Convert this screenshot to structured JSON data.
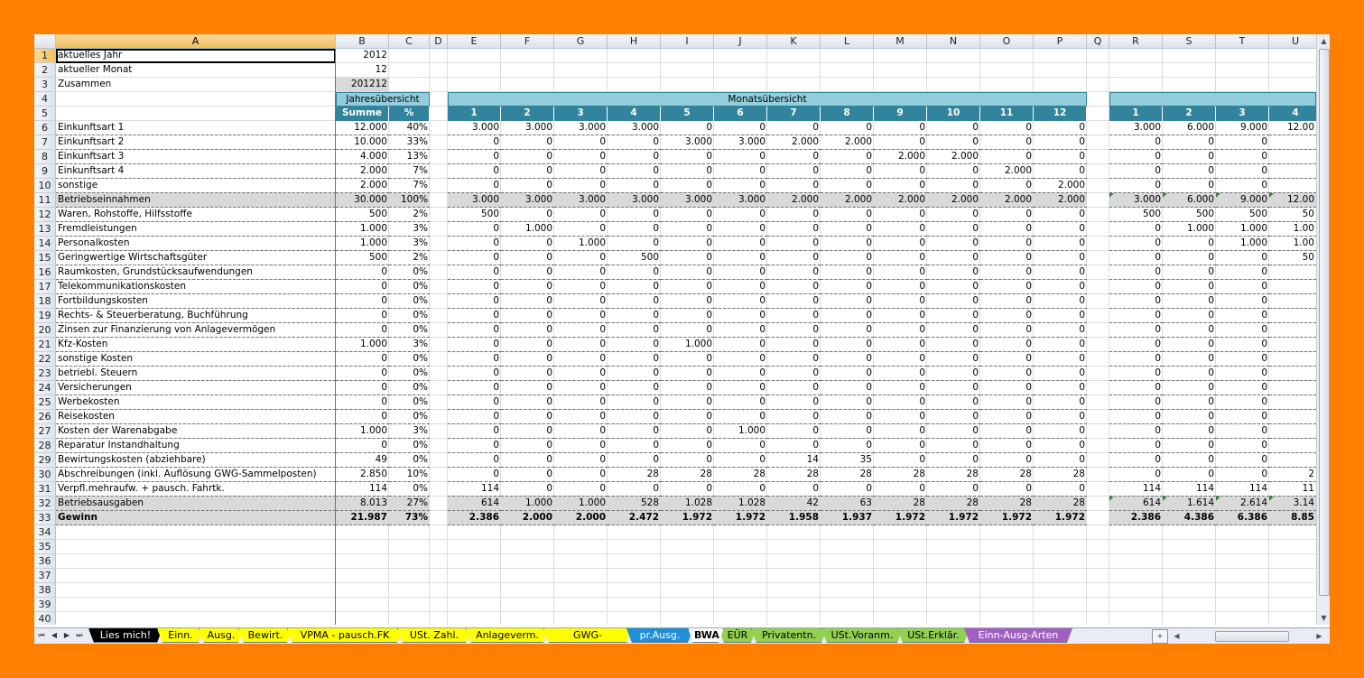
{
  "columns": [
    "A",
    "B",
    "C",
    "D",
    "E",
    "F",
    "G",
    "H",
    "I",
    "J",
    "K",
    "L",
    "M",
    "N",
    "O",
    "P",
    "Q",
    "R",
    "S",
    "T",
    "U"
  ],
  "selected_column": "A",
  "selected_row": 1,
  "header_block": {
    "jahres": "Jahresübersicht",
    "monats": "Monatsübersicht",
    "summe": "Summe",
    "percent": "%",
    "months": [
      "1",
      "2",
      "3",
      "4",
      "5",
      "6",
      "7",
      "8",
      "9",
      "10",
      "11",
      "12"
    ],
    "cum_months": [
      "1",
      "2",
      "3",
      "4"
    ]
  },
  "rows": [
    {
      "n": "1",
      "label": "aktuelles Jahr",
      "b": "2012"
    },
    {
      "n": "2",
      "label": "aktueller Monat",
      "b": "12"
    },
    {
      "n": "3",
      "label": "Zusammen",
      "b": "201212"
    },
    {
      "n": "4"
    },
    {
      "n": "5"
    },
    {
      "n": "6",
      "label": "Einkunftsart 1",
      "b": "12.000",
      "c": "40%",
      "m": [
        "3.000",
        "3.000",
        "3.000",
        "3.000",
        "0",
        "0",
        "0",
        "0",
        "0",
        "0",
        "0",
        "0"
      ],
      "r": [
        "3.000",
        "6.000",
        "9.000",
        "12.00"
      ]
    },
    {
      "n": "7",
      "label": "Einkunftsart 2",
      "b": "10.000",
      "c": "33%",
      "m": [
        "0",
        "0",
        "0",
        "0",
        "3.000",
        "3.000",
        "2.000",
        "2.000",
        "0",
        "0",
        "0",
        "0"
      ],
      "r": [
        "0",
        "0",
        "0",
        ""
      ]
    },
    {
      "n": "8",
      "label": "Einkunftsart 3",
      "b": "4.000",
      "c": "13%",
      "m": [
        "0",
        "0",
        "0",
        "0",
        "0",
        "0",
        "0",
        "0",
        "2.000",
        "2.000",
        "0",
        "0"
      ],
      "r": [
        "0",
        "0",
        "0",
        ""
      ]
    },
    {
      "n": "9",
      "label": "Einkunftsart 4",
      "b": "2.000",
      "c": "7%",
      "m": [
        "0",
        "0",
        "0",
        "0",
        "0",
        "0",
        "0",
        "0",
        "0",
        "0",
        "2.000",
        "0"
      ],
      "r": [
        "0",
        "0",
        "0",
        ""
      ]
    },
    {
      "n": "10",
      "label": "sonstige",
      "b": "2.000",
      "c": "7%",
      "m": [
        "0",
        "0",
        "0",
        "0",
        "0",
        "0",
        "0",
        "0",
        "0",
        "0",
        "0",
        "2.000"
      ],
      "r": [
        "0",
        "0",
        "0",
        ""
      ]
    },
    {
      "n": "11",
      "label": "Betriebseinnahmen",
      "b": "30.000",
      "c": "100%",
      "m": [
        "3.000",
        "3.000",
        "3.000",
        "3.000",
        "3.000",
        "3.000",
        "2.000",
        "2.000",
        "2.000",
        "2.000",
        "2.000",
        "2.000"
      ],
      "r": [
        "3.000",
        "6.000",
        "9.000",
        "12.00"
      ],
      "style": "grey"
    },
    {
      "n": "12",
      "label": "Waren, Rohstoffe, Hilfsstoffe",
      "b": "500",
      "c": "2%",
      "m": [
        "500",
        "0",
        "0",
        "0",
        "0",
        "0",
        "0",
        "0",
        "0",
        "0",
        "0",
        "0"
      ],
      "r": [
        "500",
        "500",
        "500",
        "50"
      ]
    },
    {
      "n": "13",
      "label": "Fremdleistungen",
      "b": "1.000",
      "c": "3%",
      "m": [
        "0",
        "1.000",
        "0",
        "0",
        "0",
        "0",
        "0",
        "0",
        "0",
        "0",
        "0",
        "0"
      ],
      "r": [
        "0",
        "1.000",
        "1.000",
        "1.00"
      ]
    },
    {
      "n": "14",
      "label": "Personalkosten",
      "b": "1.000",
      "c": "3%",
      "m": [
        "0",
        "0",
        "1.000",
        "0",
        "0",
        "0",
        "0",
        "0",
        "0",
        "0",
        "0",
        "0"
      ],
      "r": [
        "0",
        "0",
        "1.000",
        "1.00"
      ]
    },
    {
      "n": "15",
      "label": "Geringwertige Wirtschaftsgüter",
      "b": "500",
      "c": "2%",
      "m": [
        "0",
        "0",
        "0",
        "500",
        "0",
        "0",
        "0",
        "0",
        "0",
        "0",
        "0",
        "0"
      ],
      "r": [
        "0",
        "0",
        "0",
        "50"
      ]
    },
    {
      "n": "16",
      "label": "Raumkosten, Grundstücksaufwendungen",
      "b": "0",
      "c": "0%",
      "m": [
        "0",
        "0",
        "0",
        "0",
        "0",
        "0",
        "0",
        "0",
        "0",
        "0",
        "0",
        "0"
      ],
      "r": [
        "0",
        "0",
        "0",
        ""
      ]
    },
    {
      "n": "17",
      "label": "Telekommunikationskosten",
      "b": "0",
      "c": "0%",
      "m": [
        "0",
        "0",
        "0",
        "0",
        "0",
        "0",
        "0",
        "0",
        "0",
        "0",
        "0",
        "0"
      ],
      "r": [
        "0",
        "0",
        "0",
        ""
      ]
    },
    {
      "n": "18",
      "label": "Fortbildungskosten",
      "b": "0",
      "c": "0%",
      "m": [
        "0",
        "0",
        "0",
        "0",
        "0",
        "0",
        "0",
        "0",
        "0",
        "0",
        "0",
        "0"
      ],
      "r": [
        "0",
        "0",
        "0",
        ""
      ]
    },
    {
      "n": "19",
      "label": "Rechts- & Steuerberatung, Buchführung",
      "b": "0",
      "c": "0%",
      "m": [
        "0",
        "0",
        "0",
        "0",
        "0",
        "0",
        "0",
        "0",
        "0",
        "0",
        "0",
        "0"
      ],
      "r": [
        "0",
        "0",
        "0",
        ""
      ]
    },
    {
      "n": "20",
      "label": "Zinsen zur Finanzierung von Anlagevermögen",
      "b": "0",
      "c": "0%",
      "m": [
        "0",
        "0",
        "0",
        "0",
        "0",
        "0",
        "0",
        "0",
        "0",
        "0",
        "0",
        "0"
      ],
      "r": [
        "0",
        "0",
        "0",
        ""
      ]
    },
    {
      "n": "21",
      "label": "Kfz-Kosten",
      "b": "1.000",
      "c": "3%",
      "m": [
        "0",
        "0",
        "0",
        "0",
        "1.000",
        "0",
        "0",
        "0",
        "0",
        "0",
        "0",
        "0"
      ],
      "r": [
        "0",
        "0",
        "0",
        ""
      ]
    },
    {
      "n": "22",
      "label": "sonstige Kosten",
      "b": "0",
      "c": "0%",
      "m": [
        "0",
        "0",
        "0",
        "0",
        "0",
        "0",
        "0",
        "0",
        "0",
        "0",
        "0",
        "0"
      ],
      "r": [
        "0",
        "0",
        "0",
        ""
      ]
    },
    {
      "n": "23",
      "label": "betriebl. Steuern",
      "b": "0",
      "c": "0%",
      "m": [
        "0",
        "0",
        "0",
        "0",
        "0",
        "0",
        "0",
        "0",
        "0",
        "0",
        "0",
        "0"
      ],
      "r": [
        "0",
        "0",
        "0",
        ""
      ]
    },
    {
      "n": "24",
      "label": "Versicherungen",
      "b": "0",
      "c": "0%",
      "m": [
        "0",
        "0",
        "0",
        "0",
        "0",
        "0",
        "0",
        "0",
        "0",
        "0",
        "0",
        "0"
      ],
      "r": [
        "0",
        "0",
        "0",
        ""
      ]
    },
    {
      "n": "25",
      "label": "Werbekosten",
      "b": "0",
      "c": "0%",
      "m": [
        "0",
        "0",
        "0",
        "0",
        "0",
        "0",
        "0",
        "0",
        "0",
        "0",
        "0",
        "0"
      ],
      "r": [
        "0",
        "0",
        "0",
        ""
      ]
    },
    {
      "n": "26",
      "label": "Reisekosten",
      "b": "0",
      "c": "0%",
      "m": [
        "0",
        "0",
        "0",
        "0",
        "0",
        "0",
        "0",
        "0",
        "0",
        "0",
        "0",
        "0"
      ],
      "r": [
        "0",
        "0",
        "0",
        ""
      ]
    },
    {
      "n": "27",
      "label": "Kosten der Warenabgabe",
      "b": "1.000",
      "c": "3%",
      "m": [
        "0",
        "0",
        "0",
        "0",
        "0",
        "1.000",
        "0",
        "0",
        "0",
        "0",
        "0",
        "0"
      ],
      "r": [
        "0",
        "0",
        "0",
        ""
      ]
    },
    {
      "n": "28",
      "label": "Reparatur Instandhaltung",
      "b": "0",
      "c": "0%",
      "m": [
        "0",
        "0",
        "0",
        "0",
        "0",
        "0",
        "0",
        "0",
        "0",
        "0",
        "0",
        "0"
      ],
      "r": [
        "0",
        "0",
        "0",
        ""
      ]
    },
    {
      "n": "29",
      "label": "Bewirtungskosten (abziehbare)",
      "b": "49",
      "c": "0%",
      "m": [
        "0",
        "0",
        "0",
        "0",
        "0",
        "0",
        "14",
        "35",
        "0",
        "0",
        "0",
        "0"
      ],
      "r": [
        "0",
        "0",
        "0",
        ""
      ]
    },
    {
      "n": "30",
      "label": "Abschreibungen (inkl. Auflösung GWG-Sammelposten)",
      "b": "2.850",
      "c": "10%",
      "m": [
        "0",
        "0",
        "0",
        "28",
        "28",
        "28",
        "28",
        "28",
        "28",
        "28",
        "28",
        "28"
      ],
      "r": [
        "0",
        "0",
        "0",
        "2"
      ]
    },
    {
      "n": "31",
      "label": "Verpfl.mehraufw. + pausch. Fahrtk.",
      "b": "114",
      "c": "0%",
      "m": [
        "114",
        "0",
        "0",
        "0",
        "0",
        "0",
        "0",
        "0",
        "0",
        "0",
        "0",
        "0"
      ],
      "r": [
        "114",
        "114",
        "114",
        "11"
      ]
    },
    {
      "n": "32",
      "label": "Betriebsausgaben",
      "b": "8.013",
      "c": "27%",
      "m": [
        "614",
        "1.000",
        "1.000",
        "528",
        "1.028",
        "1.028",
        "42",
        "63",
        "28",
        "28",
        "28",
        "28"
      ],
      "r": [
        "614",
        "1.614",
        "2.614",
        "3.14"
      ],
      "style": "grey"
    },
    {
      "n": "33",
      "label": "Gewinn",
      "b": "21.987",
      "c": "73%",
      "m": [
        "2.386",
        "2.000",
        "2.000",
        "2.472",
        "1.972",
        "1.972",
        "1.958",
        "1.937",
        "1.972",
        "1.972",
        "1.972",
        "1.972"
      ],
      "r": [
        "2.386",
        "4.386",
        "6.386",
        "8.85"
      ],
      "style": "greybold"
    },
    {
      "n": "34"
    },
    {
      "n": "35"
    },
    {
      "n": "36"
    },
    {
      "n": "37"
    },
    {
      "n": "38"
    },
    {
      "n": "39"
    },
    {
      "n": "40"
    }
  ],
  "tabs": [
    {
      "label": "Lies mich!",
      "bg": "#000000",
      "fg": "#ffffff"
    },
    {
      "label": "Einn.",
      "bg": "#ffff00",
      "fg": "#000000"
    },
    {
      "label": "Ausg.",
      "bg": "#ffff00",
      "fg": "#000000"
    },
    {
      "label": "Bewirt.",
      "bg": "#ffff00",
      "fg": "#000000"
    },
    {
      "label": "VPMA - pausch.FK",
      "bg": "#ffff00",
      "fg": "#000000"
    },
    {
      "label": "USt. Zahl.",
      "bg": "#ffff00",
      "fg": "#000000"
    },
    {
      "label": "Anlageverm.",
      "bg": "#ffff00",
      "fg": "#000000"
    },
    {
      "label": "GWG-Sammelp.",
      "bg": "#ffff00",
      "fg": "#000000"
    },
    {
      "label": "pr.Ausg.",
      "bg": "#1f8fd6",
      "fg": "#ffffff"
    },
    {
      "label": "BWA",
      "bg": "#ffffff",
      "fg": "#000000",
      "active": true
    },
    {
      "label": "EÜR",
      "bg": "#92d050",
      "fg": "#000000"
    },
    {
      "label": "Privatentn.",
      "bg": "#92d050",
      "fg": "#000000"
    },
    {
      "label": "USt.Voranm.",
      "bg": "#92d050",
      "fg": "#000000"
    },
    {
      "label": "USt.Erklär.",
      "bg": "#92d050",
      "fg": "#000000"
    },
    {
      "label": "Einn-Ausg-Arten",
      "bg": "#a060c0",
      "fg": "#ffffff"
    }
  ],
  "colors": {
    "teal": "#31849b",
    "lightblue": "#92cddc",
    "grey": "#d9d9d9",
    "frame": "#ff7f00"
  }
}
